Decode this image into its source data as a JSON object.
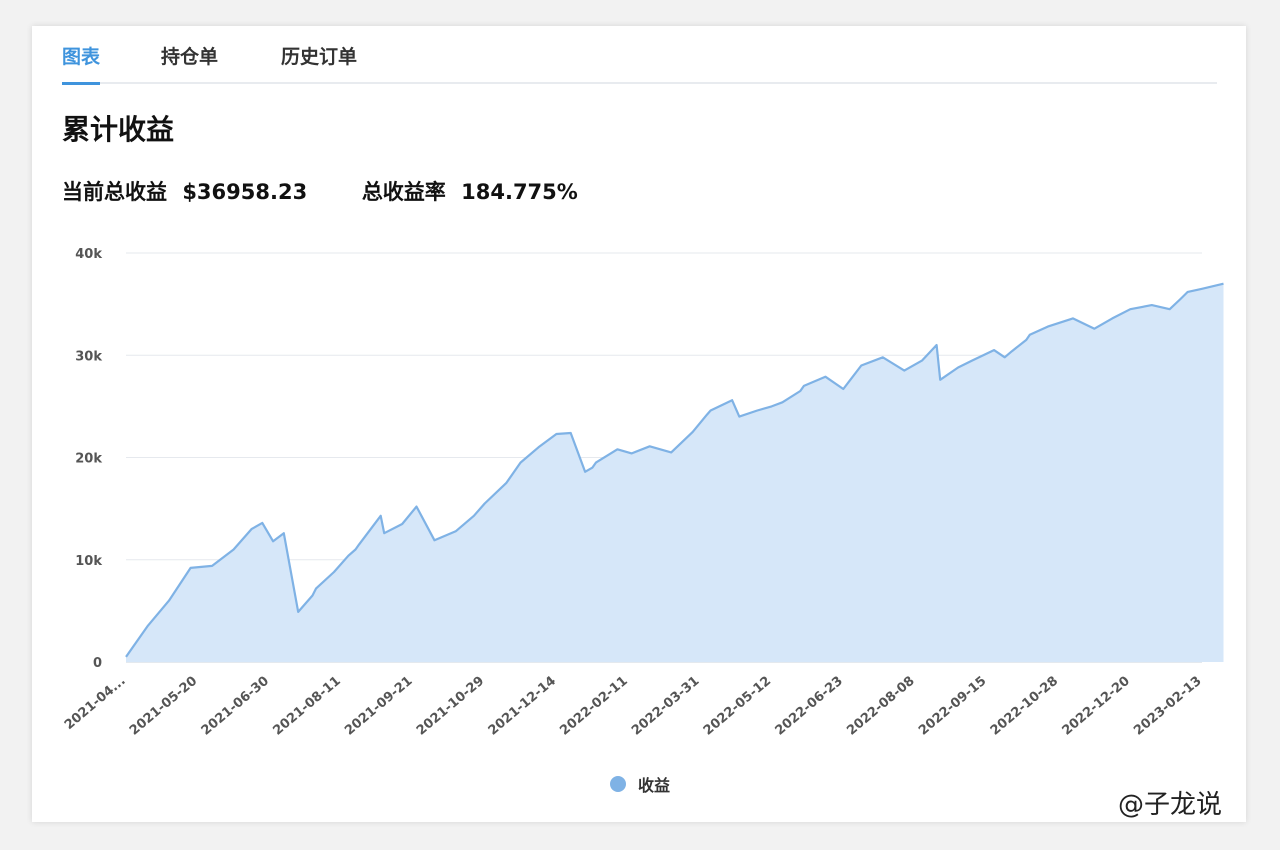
{
  "tabs": [
    {
      "label": "图表",
      "active": true
    },
    {
      "label": "持仓单",
      "active": false
    },
    {
      "label": "历史订单",
      "active": false
    }
  ],
  "page_title": "累计收益",
  "stats": {
    "total_profit_label": "当前总收益",
    "total_profit_value": "$36958.23",
    "profit_rate_label": "总收益率",
    "profit_rate_value": "184.775%"
  },
  "legend": {
    "label": "收益",
    "color": "#7fb2e5"
  },
  "watermark": "@子龙说",
  "chart_data": {
    "type": "area",
    "title": "",
    "xlabel": "",
    "ylabel": "",
    "ylim": [
      0,
      40000
    ],
    "yticks": [
      "0",
      "10k",
      "20k",
      "30k",
      "40k"
    ],
    "x_tick_labels": [
      "2021-04...",
      "2021-05-20",
      "2021-06-30",
      "2021-08-11",
      "2021-09-21",
      "2021-10-29",
      "2021-12-14",
      "2022-02-11",
      "2022-03-31",
      "2022-05-12",
      "2022-06-23",
      "2022-08-08",
      "2022-09-15",
      "2022-10-28",
      "2022-12-20",
      "2023-02-13"
    ],
    "grid": true,
    "line_color": "#7fb2e5",
    "fill_color": "#d6e7f9",
    "series": [
      {
        "name": "收益",
        "x": [
          0,
          0.3,
          0.6,
          0.9,
          1.2,
          1.5,
          1.75,
          1.9,
          2.05,
          2.2,
          2.4,
          2.6,
          2.65,
          2.9,
          3.1,
          3.2,
          3.25,
          3.55,
          3.6,
          3.85,
          4.05,
          4.3,
          4.6,
          4.85,
          5.0,
          5.3,
          5.5,
          5.75,
          6.0,
          6.2,
          6.4,
          6.5,
          6.55,
          6.85,
          7.05,
          7.3,
          7.6,
          7.9,
          8.1,
          8.15,
          8.45,
          8.55,
          8.8,
          9.0,
          9.15,
          9.4,
          9.45,
          9.75,
          10.0,
          10.25,
          10.55,
          10.85,
          11.1,
          11.3,
          11.35,
          11.6,
          11.8,
          12.1,
          12.25,
          12.35,
          12.55,
          12.6,
          12.85,
          13.2,
          13.5,
          13.75,
          14.0,
          14.3,
          14.55,
          14.7,
          14.8,
          15.0,
          15.3
        ],
        "y": [
          500,
          3500,
          6000,
          9200,
          9400,
          11000,
          13000,
          13600,
          11800,
          12600,
          4900,
          6500,
          7200,
          8800,
          10400,
          11000,
          11500,
          14300,
          12600,
          13500,
          15200,
          11900,
          12800,
          14300,
          15500,
          17500,
          19500,
          21000,
          22300,
          22400,
          18600,
          19000,
          19500,
          20800,
          20400,
          21100,
          20500,
          22500,
          24200,
          24600,
          25600,
          24000,
          24600,
          25000,
          25400,
          26500,
          27000,
          27900,
          26700,
          29000,
          29800,
          28500,
          29500,
          31000,
          27600,
          28800,
          29500,
          30500,
          29800,
          30400,
          31500,
          32000,
          32800,
          33600,
          32600,
          33600,
          34500,
          34900,
          34500,
          35500,
          36200,
          36500,
          37000
        ]
      }
    ]
  }
}
